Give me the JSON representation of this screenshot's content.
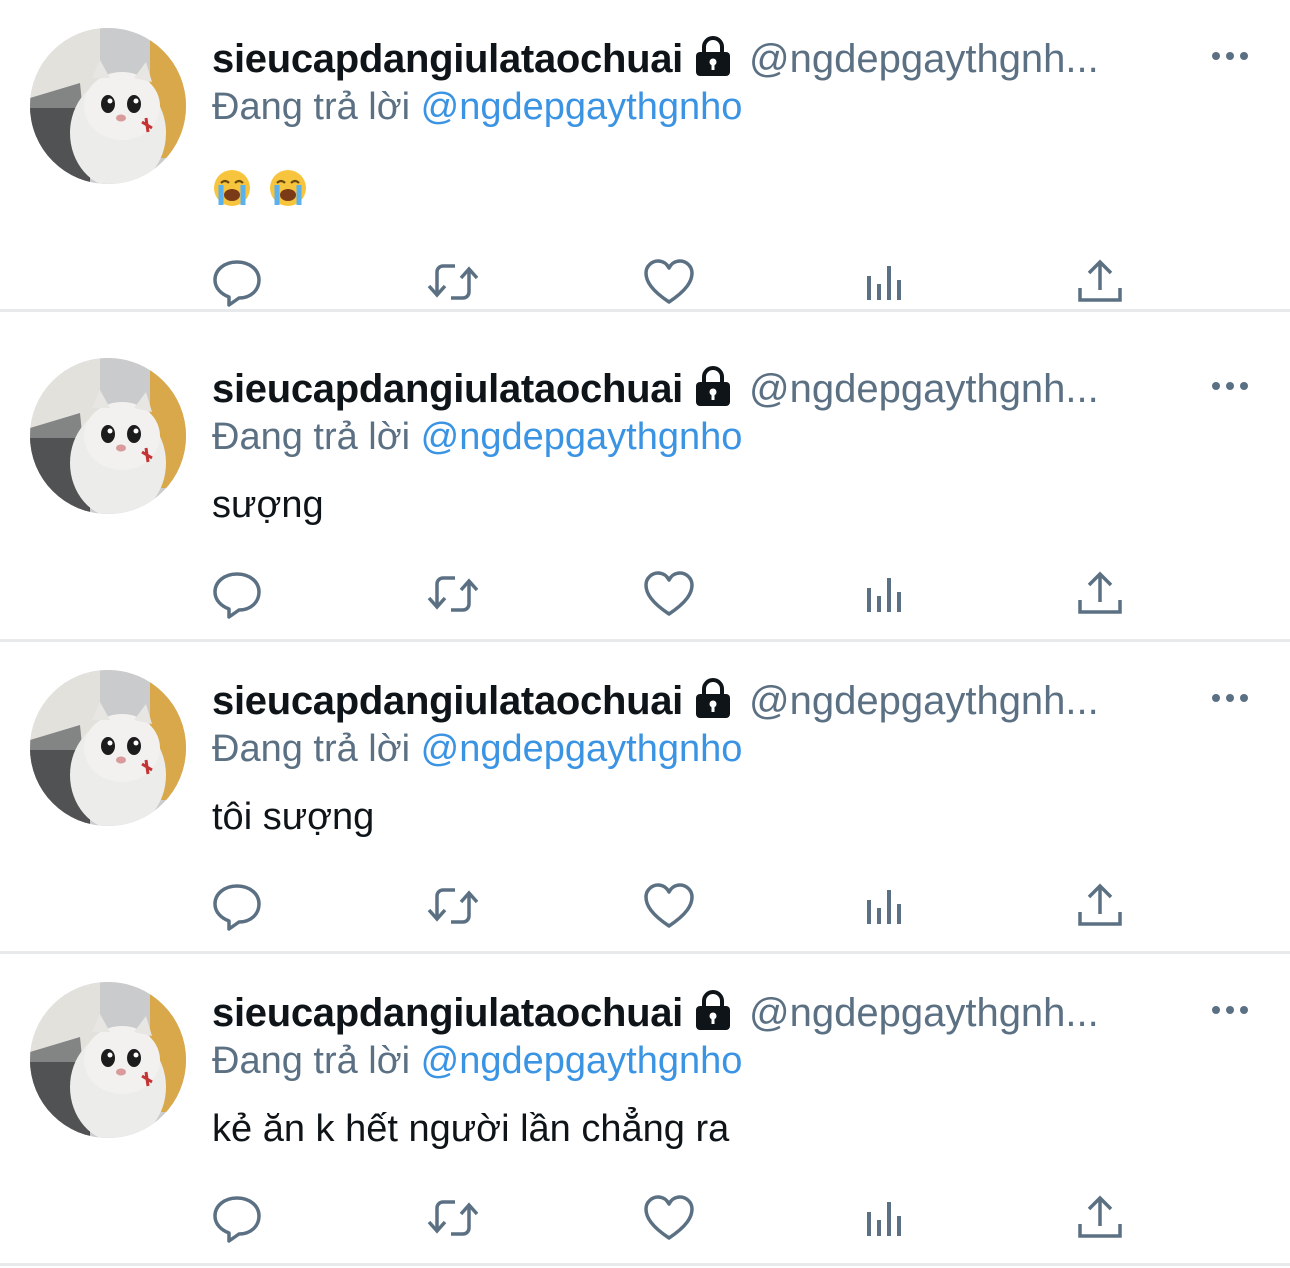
{
  "tweets": [
    {
      "display_name": "sieucapdangiulataochuai",
      "handle": "@ngdepgaythgnh...",
      "reply_prefix": "Đang trả lời",
      "reply_to": "@ngdepgaythgnho",
      "text": "",
      "emojis": [
        "loudly-crying-face-emoji",
        "loudly-crying-face-emoji"
      ]
    },
    {
      "display_name": "sieucapdangiulataochuai",
      "handle": "@ngdepgaythgnh...",
      "reply_prefix": "Đang trả lời",
      "reply_to": "@ngdepgaythgnho",
      "text": "sượng",
      "emojis": []
    },
    {
      "display_name": "sieucapdangiulataochuai",
      "handle": "@ngdepgaythgnh...",
      "reply_prefix": "Đang trả lời",
      "reply_to": "@ngdepgaythgnho",
      "text": "tôi sượng",
      "emojis": []
    },
    {
      "display_name": "sieucapdangiulataochuai",
      "handle": "@ngdepgaythgnh...",
      "reply_prefix": "Đang trả lời",
      "reply_to": "@ngdepgaythgnho",
      "text": "kẻ ăn k hết người lần chẳng ra",
      "emojis": []
    }
  ],
  "icons": {
    "lock": "lock-icon",
    "more": "more-options-icon",
    "reply": "reply-icon",
    "retweet": "retweet-icon",
    "like": "like-icon",
    "analytics": "analytics-icon",
    "share": "share-icon"
  },
  "colors": {
    "text": "#0f1419",
    "muted": "#5b7083",
    "mention": "#3a94e3",
    "divider": "#e7e9eb",
    "icon": "#5b7083"
  }
}
